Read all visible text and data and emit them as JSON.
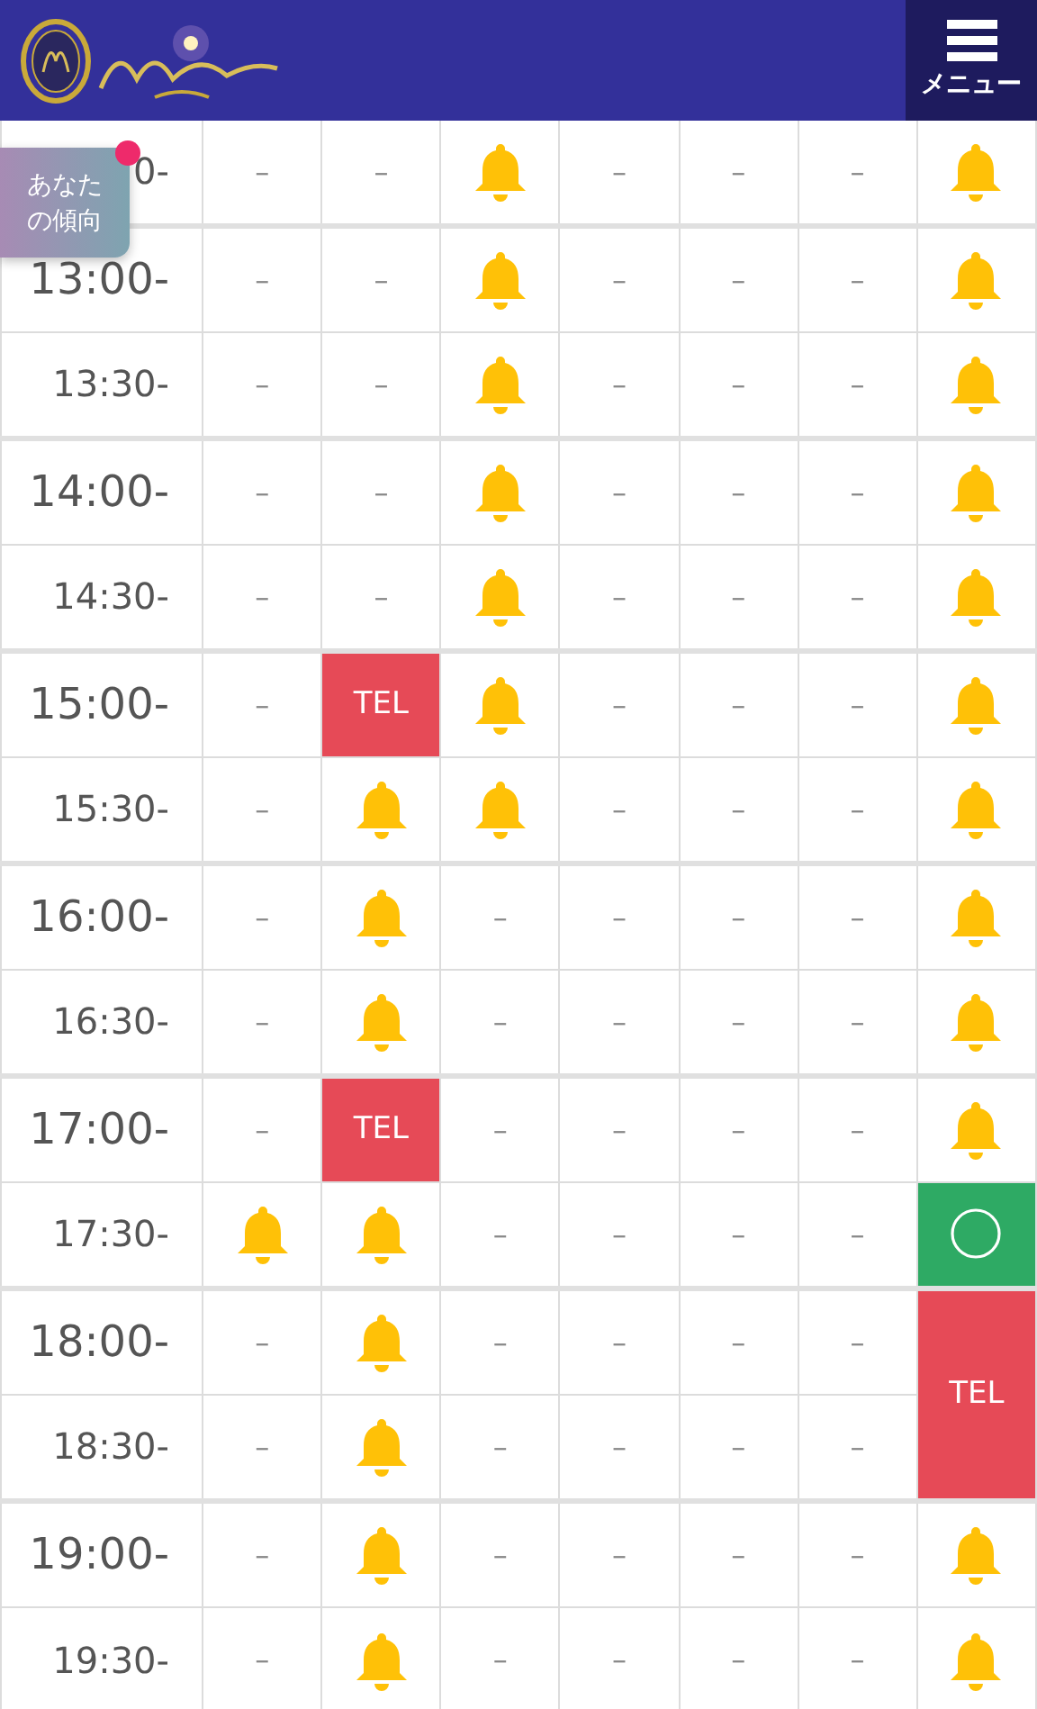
{
  "header": {
    "menu_label": "メニュー"
  },
  "badge": {
    "text": "あなたの傾向"
  },
  "rows": [
    {
      "time": "0-",
      "major": false,
      "cells": [
        {
          "kind": "dash",
          "text": "–"
        },
        {
          "kind": "dash",
          "text": "–"
        },
        {
          "kind": "bell"
        },
        {
          "kind": "dash",
          "text": "–"
        },
        {
          "kind": "dash",
          "text": "–"
        },
        {
          "kind": "dash",
          "text": "–"
        },
        {
          "kind": "bell"
        }
      ]
    },
    {
      "time": "13:00-",
      "major": true,
      "cells": [
        {
          "kind": "dash",
          "text": "–"
        },
        {
          "kind": "dash",
          "text": "–"
        },
        {
          "kind": "bell"
        },
        {
          "kind": "dash",
          "text": "–"
        },
        {
          "kind": "dash",
          "text": "–"
        },
        {
          "kind": "dash",
          "text": "–"
        },
        {
          "kind": "bell"
        }
      ]
    },
    {
      "time": "13:30-",
      "major": false,
      "cells": [
        {
          "kind": "dash",
          "text": "–"
        },
        {
          "kind": "dash",
          "text": "–"
        },
        {
          "kind": "bell"
        },
        {
          "kind": "dash",
          "text": "–"
        },
        {
          "kind": "dash",
          "text": "–"
        },
        {
          "kind": "dash",
          "text": "–"
        },
        {
          "kind": "bell"
        }
      ]
    },
    {
      "time": "14:00-",
      "major": true,
      "cells": [
        {
          "kind": "dash",
          "text": "–"
        },
        {
          "kind": "dash",
          "text": "–"
        },
        {
          "kind": "bell"
        },
        {
          "kind": "dash",
          "text": "–"
        },
        {
          "kind": "dash",
          "text": "–"
        },
        {
          "kind": "dash",
          "text": "–"
        },
        {
          "kind": "bell"
        }
      ]
    },
    {
      "time": "14:30-",
      "major": false,
      "cells": [
        {
          "kind": "dash",
          "text": "–"
        },
        {
          "kind": "dash",
          "text": "–"
        },
        {
          "kind": "bell"
        },
        {
          "kind": "dash",
          "text": "–"
        },
        {
          "kind": "dash",
          "text": "–"
        },
        {
          "kind": "dash",
          "text": "–"
        },
        {
          "kind": "bell"
        }
      ]
    },
    {
      "time": "15:00-",
      "major": true,
      "cells": [
        {
          "kind": "dash",
          "text": "–"
        },
        {
          "kind": "tel",
          "text": "TEL"
        },
        {
          "kind": "bell"
        },
        {
          "kind": "dash",
          "text": "–"
        },
        {
          "kind": "dash",
          "text": "–"
        },
        {
          "kind": "dash",
          "text": "–"
        },
        {
          "kind": "bell"
        }
      ]
    },
    {
      "time": "15:30-",
      "major": false,
      "cells": [
        {
          "kind": "dash",
          "text": "–"
        },
        {
          "kind": "bell"
        },
        {
          "kind": "bell"
        },
        {
          "kind": "dash",
          "text": "–"
        },
        {
          "kind": "dash",
          "text": "–"
        },
        {
          "kind": "dash",
          "text": "–"
        },
        {
          "kind": "bell"
        }
      ]
    },
    {
      "time": "16:00-",
      "major": true,
      "cells": [
        {
          "kind": "dash",
          "text": "–"
        },
        {
          "kind": "bell"
        },
        {
          "kind": "dash",
          "text": "–"
        },
        {
          "kind": "dash",
          "text": "–"
        },
        {
          "kind": "dash",
          "text": "–"
        },
        {
          "kind": "dash",
          "text": "–"
        },
        {
          "kind": "bell"
        }
      ]
    },
    {
      "time": "16:30-",
      "major": false,
      "cells": [
        {
          "kind": "dash",
          "text": "–"
        },
        {
          "kind": "bell"
        },
        {
          "kind": "dash",
          "text": "–"
        },
        {
          "kind": "dash",
          "text": "–"
        },
        {
          "kind": "dash",
          "text": "–"
        },
        {
          "kind": "dash",
          "text": "–"
        },
        {
          "kind": "bell"
        }
      ]
    },
    {
      "time": "17:00-",
      "major": true,
      "cells": [
        {
          "kind": "dash",
          "text": "–"
        },
        {
          "kind": "tel",
          "text": "TEL"
        },
        {
          "kind": "dash",
          "text": "–"
        },
        {
          "kind": "dash",
          "text": "–"
        },
        {
          "kind": "dash",
          "text": "–"
        },
        {
          "kind": "dash",
          "text": "–"
        },
        {
          "kind": "bell"
        }
      ]
    },
    {
      "time": "17:30-",
      "major": false,
      "cells": [
        {
          "kind": "bell"
        },
        {
          "kind": "bell"
        },
        {
          "kind": "dash",
          "text": "–"
        },
        {
          "kind": "dash",
          "text": "–"
        },
        {
          "kind": "dash",
          "text": "–"
        },
        {
          "kind": "dash",
          "text": "–"
        },
        {
          "kind": "ok"
        }
      ]
    },
    {
      "time": "18:00-",
      "major": true,
      "cells": [
        {
          "kind": "dash",
          "text": "–"
        },
        {
          "kind": "bell"
        },
        {
          "kind": "dash",
          "text": "–"
        },
        {
          "kind": "dash",
          "text": "–"
        },
        {
          "kind": "dash",
          "text": "–"
        },
        {
          "kind": "dash",
          "text": "–"
        },
        {
          "kind": "tel",
          "text": "TEL",
          "merged_down": true
        }
      ]
    },
    {
      "time": "18:30-",
      "major": false,
      "cells": [
        {
          "kind": "dash",
          "text": "–"
        },
        {
          "kind": "bell"
        },
        {
          "kind": "dash",
          "text": "–"
        },
        {
          "kind": "dash",
          "text": "–"
        },
        {
          "kind": "dash",
          "text": "–"
        },
        {
          "kind": "dash",
          "text": "–"
        }
      ]
    },
    {
      "time": "19:00-",
      "major": true,
      "cells": [
        {
          "kind": "dash",
          "text": "–"
        },
        {
          "kind": "bell"
        },
        {
          "kind": "dash",
          "text": "–"
        },
        {
          "kind": "dash",
          "text": "–"
        },
        {
          "kind": "dash",
          "text": "–"
        },
        {
          "kind": "dash",
          "text": "–"
        },
        {
          "kind": "bell"
        }
      ]
    },
    {
      "time": "19:30-",
      "major": false,
      "cells": [
        {
          "kind": "dash",
          "text": "–"
        },
        {
          "kind": "bell"
        },
        {
          "kind": "dash",
          "text": "–"
        },
        {
          "kind": "dash",
          "text": "–"
        },
        {
          "kind": "dash",
          "text": "–"
        },
        {
          "kind": "dash",
          "text": "–"
        },
        {
          "kind": "bell"
        }
      ]
    }
  ]
}
